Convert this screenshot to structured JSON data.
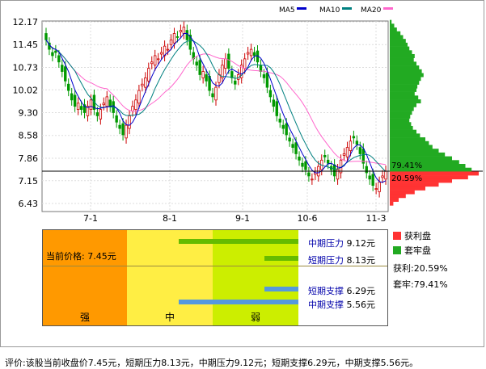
{
  "chart_data": [
    {
      "type": "candlestick",
      "legend": [
        "MA5",
        "MA10",
        "MA20"
      ],
      "legend_colors": {
        "MA5": "#0000cc",
        "MA10": "#008080",
        "MA20": "#ff66cc"
      },
      "y_ticks": [
        "12.17",
        "11.45",
        "10.73",
        "10.02",
        "9.30",
        "8.58",
        "7.86",
        "7.15",
        "6.43"
      ],
      "ylim": [
        6.43,
        12.17
      ],
      "x_ticks": [
        "7-1",
        "8-1",
        "9-1",
        "10-6",
        "11-3"
      ],
      "closes": [
        11.6,
        11.3,
        11.1,
        11.2,
        10.9,
        10.6,
        10.3,
        10.0,
        9.7,
        9.5,
        9.6,
        9.4,
        9.3,
        9.5,
        9.7,
        9.4,
        9.2,
        9.4,
        9.6,
        9.8,
        9.5,
        9.3,
        9.0,
        8.8,
        8.6,
        8.9,
        9.2,
        9.5,
        9.7,
        10.0,
        10.2,
        10.4,
        10.7,
        10.9,
        11.1,
        11.0,
        11.2,
        11.4,
        11.3,
        11.6,
        11.8,
        11.7,
        11.9,
        12.0,
        11.6,
        11.3,
        11.0,
        10.8,
        10.5,
        10.6,
        10.3,
        10.0,
        9.8,
        10.1,
        10.5,
        10.8,
        11.0,
        10.7,
        10.4,
        10.2,
        10.5,
        10.8,
        11.0,
        11.2,
        11.3,
        11.1,
        10.9,
        10.6,
        10.4,
        10.1,
        9.8,
        9.5,
        9.2,
        9.0,
        8.8,
        8.6,
        8.4,
        8.2,
        8.0,
        7.8,
        7.6,
        7.5,
        7.3,
        7.2,
        7.4,
        7.6,
        7.8,
        7.9,
        7.7,
        7.5,
        7.3,
        7.5,
        7.8,
        8.0,
        8.2,
        8.4,
        8.5,
        8.3,
        8.0,
        7.7,
        7.4,
        7.2,
        7.0,
        6.9,
        7.1,
        7.3,
        7.45
      ],
      "ma5_color": "#0000cc",
      "ma10_color": "#008080",
      "ma20_color": "#ff66cc",
      "up_color": "#cc0000",
      "down_color": "#009900",
      "current_price_line": 7.45
    },
    {
      "type": "bar",
      "orientation": "horizontal",
      "name": "chip-distribution",
      "profit_ratio_label": "79.41%",
      "trapped_ratio_label": "20.59%",
      "levels": [
        12.17,
        12.05,
        11.93,
        11.81,
        11.69,
        11.57,
        11.45,
        11.33,
        11.21,
        11.09,
        10.97,
        10.85,
        10.73,
        10.61,
        10.49,
        10.37,
        10.25,
        10.13,
        10.02,
        9.9,
        9.78,
        9.66,
        9.54,
        9.42,
        9.3,
        9.18,
        9.06,
        8.94,
        8.82,
        8.7,
        8.58,
        8.46,
        8.34,
        8.22,
        8.1,
        7.98,
        7.86,
        7.74,
        7.62,
        7.5,
        7.38,
        7.26,
        7.15,
        7.03,
        6.91,
        6.79,
        6.67,
        6.55,
        6.43
      ],
      "values": [
        0.02,
        0.05,
        0.08,
        0.12,
        0.15,
        0.18,
        0.2,
        0.22,
        0.25,
        0.28,
        0.27,
        0.3,
        0.33,
        0.36,
        0.38,
        0.35,
        0.33,
        0.31,
        0.3,
        0.28,
        0.32,
        0.35,
        0.3,
        0.27,
        0.25,
        0.23,
        0.22,
        0.24,
        0.26,
        0.3,
        0.34,
        0.4,
        0.44,
        0.48,
        0.55,
        0.62,
        0.7,
        0.78,
        0.85,
        0.92,
        1.0,
        0.88,
        0.7,
        0.55,
        0.4,
        0.28,
        0.18,
        0.1,
        0.04
      ],
      "profit_color": "#22aa22",
      "trapped_color": "#ff3333"
    }
  ],
  "panel": {
    "price_label": "当前价格:",
    "price_value": "7.45元",
    "zones": [
      {
        "label": "强",
        "color": "#ff9900"
      },
      {
        "label": "中",
        "color": "#ffee44"
      },
      {
        "label": "弱",
        "color": "#ccee00"
      }
    ],
    "levels": [
      {
        "name": "中期压力",
        "value": "9.12元",
        "bar_color": "#66bb00"
      },
      {
        "name": "短期压力",
        "value": "8.13元",
        "bar_color": "#66bb00"
      },
      {
        "name": "短期支撑",
        "value": "6.29元",
        "bar_color": "#5599dd"
      },
      {
        "name": "中期支撑",
        "value": "5.56元",
        "bar_color": "#5599dd"
      }
    ]
  },
  "legend2": {
    "profit_label": "获利盘",
    "trapped_label": "套牢盘",
    "profit_color": "#ff3333",
    "trapped_color": "#22aa22",
    "profit_ratio": "获利:20.59%",
    "trapped_ratio": "套牢:79.41%"
  },
  "caption": "评价:该股当前收盘价7.45元，短期压力8.13元，中期压力9.12元；短期支撑6.29元，中期支撑5.56元。"
}
